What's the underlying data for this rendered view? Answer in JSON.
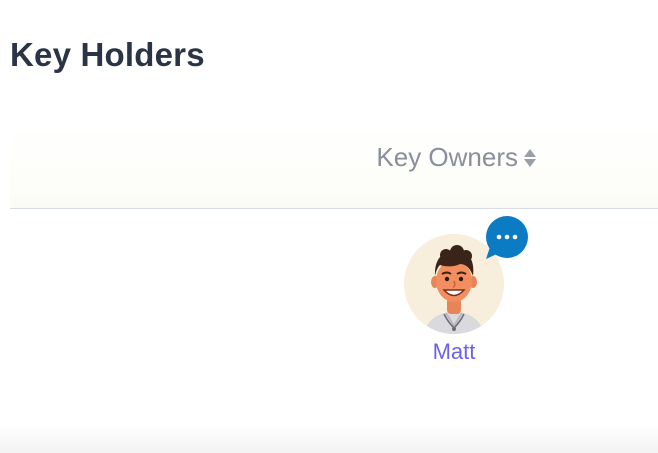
{
  "page": {
    "title": "Key Holders"
  },
  "table": {
    "columns": [
      {
        "label": "Key Owners",
        "sortable": true
      }
    ],
    "rows": [
      {
        "owner_name": "Matt",
        "avatar_icon": "person-avatar-icon",
        "badge_icon": "chat-bubble-more-icon"
      }
    ]
  },
  "colors": {
    "title": "#2b3445",
    "header_text": "#8a8f99",
    "link": "#6a63e8",
    "badge": "#0b7bc4",
    "avatar_bg": "#f7efdc"
  }
}
